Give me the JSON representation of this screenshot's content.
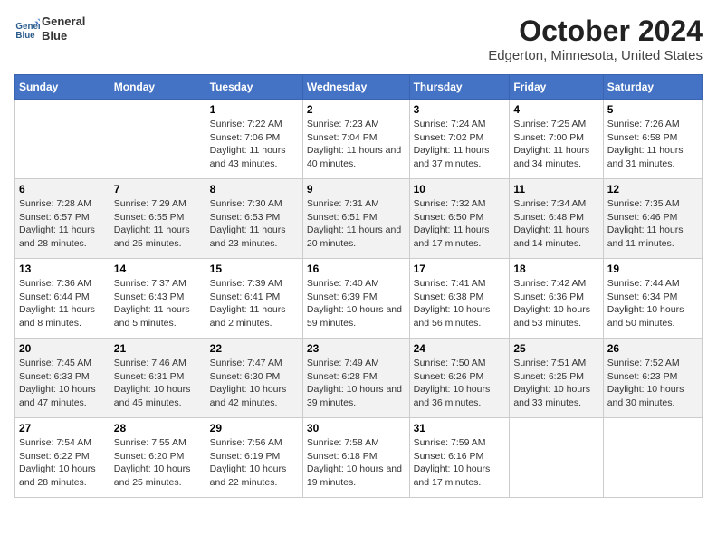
{
  "header": {
    "logo_line1": "General",
    "logo_line2": "Blue",
    "title": "October 2024",
    "subtitle": "Edgerton, Minnesota, United States"
  },
  "days_of_week": [
    "Sunday",
    "Monday",
    "Tuesday",
    "Wednesday",
    "Thursday",
    "Friday",
    "Saturday"
  ],
  "weeks": [
    [
      {
        "day": null,
        "content": null
      },
      {
        "day": null,
        "content": null
      },
      {
        "day": "1",
        "content": "Sunrise: 7:22 AM\nSunset: 7:06 PM\nDaylight: 11 hours and 43 minutes."
      },
      {
        "day": "2",
        "content": "Sunrise: 7:23 AM\nSunset: 7:04 PM\nDaylight: 11 hours and 40 minutes."
      },
      {
        "day": "3",
        "content": "Sunrise: 7:24 AM\nSunset: 7:02 PM\nDaylight: 11 hours and 37 minutes."
      },
      {
        "day": "4",
        "content": "Sunrise: 7:25 AM\nSunset: 7:00 PM\nDaylight: 11 hours and 34 minutes."
      },
      {
        "day": "5",
        "content": "Sunrise: 7:26 AM\nSunset: 6:58 PM\nDaylight: 11 hours and 31 minutes."
      }
    ],
    [
      {
        "day": "6",
        "content": "Sunrise: 7:28 AM\nSunset: 6:57 PM\nDaylight: 11 hours and 28 minutes."
      },
      {
        "day": "7",
        "content": "Sunrise: 7:29 AM\nSunset: 6:55 PM\nDaylight: 11 hours and 25 minutes."
      },
      {
        "day": "8",
        "content": "Sunrise: 7:30 AM\nSunset: 6:53 PM\nDaylight: 11 hours and 23 minutes."
      },
      {
        "day": "9",
        "content": "Sunrise: 7:31 AM\nSunset: 6:51 PM\nDaylight: 11 hours and 20 minutes."
      },
      {
        "day": "10",
        "content": "Sunrise: 7:32 AM\nSunset: 6:50 PM\nDaylight: 11 hours and 17 minutes."
      },
      {
        "day": "11",
        "content": "Sunrise: 7:34 AM\nSunset: 6:48 PM\nDaylight: 11 hours and 14 minutes."
      },
      {
        "day": "12",
        "content": "Sunrise: 7:35 AM\nSunset: 6:46 PM\nDaylight: 11 hours and 11 minutes."
      }
    ],
    [
      {
        "day": "13",
        "content": "Sunrise: 7:36 AM\nSunset: 6:44 PM\nDaylight: 11 hours and 8 minutes."
      },
      {
        "day": "14",
        "content": "Sunrise: 7:37 AM\nSunset: 6:43 PM\nDaylight: 11 hours and 5 minutes."
      },
      {
        "day": "15",
        "content": "Sunrise: 7:39 AM\nSunset: 6:41 PM\nDaylight: 11 hours and 2 minutes."
      },
      {
        "day": "16",
        "content": "Sunrise: 7:40 AM\nSunset: 6:39 PM\nDaylight: 10 hours and 59 minutes."
      },
      {
        "day": "17",
        "content": "Sunrise: 7:41 AM\nSunset: 6:38 PM\nDaylight: 10 hours and 56 minutes."
      },
      {
        "day": "18",
        "content": "Sunrise: 7:42 AM\nSunset: 6:36 PM\nDaylight: 10 hours and 53 minutes."
      },
      {
        "day": "19",
        "content": "Sunrise: 7:44 AM\nSunset: 6:34 PM\nDaylight: 10 hours and 50 minutes."
      }
    ],
    [
      {
        "day": "20",
        "content": "Sunrise: 7:45 AM\nSunset: 6:33 PM\nDaylight: 10 hours and 47 minutes."
      },
      {
        "day": "21",
        "content": "Sunrise: 7:46 AM\nSunset: 6:31 PM\nDaylight: 10 hours and 45 minutes."
      },
      {
        "day": "22",
        "content": "Sunrise: 7:47 AM\nSunset: 6:30 PM\nDaylight: 10 hours and 42 minutes."
      },
      {
        "day": "23",
        "content": "Sunrise: 7:49 AM\nSunset: 6:28 PM\nDaylight: 10 hours and 39 minutes."
      },
      {
        "day": "24",
        "content": "Sunrise: 7:50 AM\nSunset: 6:26 PM\nDaylight: 10 hours and 36 minutes."
      },
      {
        "day": "25",
        "content": "Sunrise: 7:51 AM\nSunset: 6:25 PM\nDaylight: 10 hours and 33 minutes."
      },
      {
        "day": "26",
        "content": "Sunrise: 7:52 AM\nSunset: 6:23 PM\nDaylight: 10 hours and 30 minutes."
      }
    ],
    [
      {
        "day": "27",
        "content": "Sunrise: 7:54 AM\nSunset: 6:22 PM\nDaylight: 10 hours and 28 minutes."
      },
      {
        "day": "28",
        "content": "Sunrise: 7:55 AM\nSunset: 6:20 PM\nDaylight: 10 hours and 25 minutes."
      },
      {
        "day": "29",
        "content": "Sunrise: 7:56 AM\nSunset: 6:19 PM\nDaylight: 10 hours and 22 minutes."
      },
      {
        "day": "30",
        "content": "Sunrise: 7:58 AM\nSunset: 6:18 PM\nDaylight: 10 hours and 19 minutes."
      },
      {
        "day": "31",
        "content": "Sunrise: 7:59 AM\nSunset: 6:16 PM\nDaylight: 10 hours and 17 minutes."
      },
      {
        "day": null,
        "content": null
      },
      {
        "day": null,
        "content": null
      }
    ]
  ]
}
